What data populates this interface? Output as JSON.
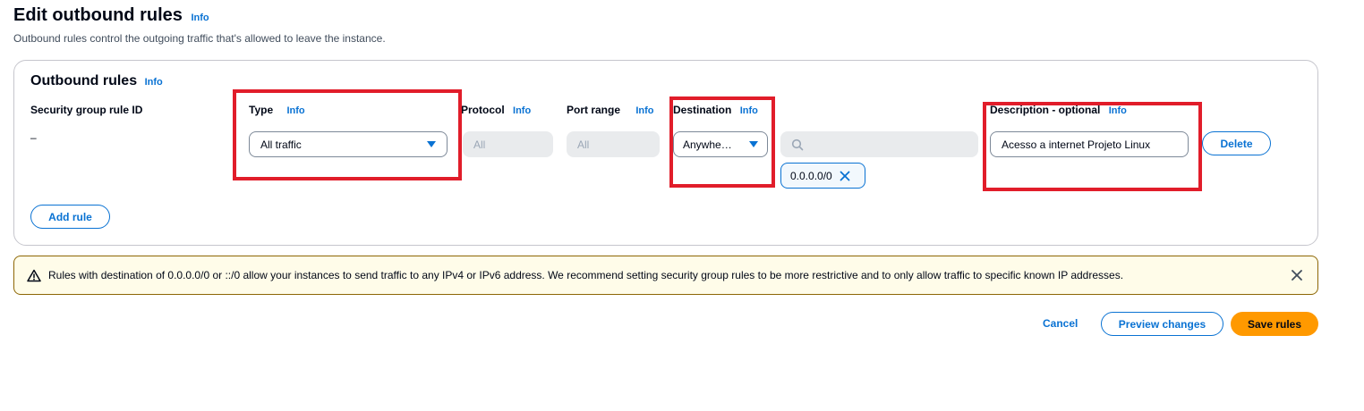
{
  "header": {
    "title": "Edit outbound rules",
    "info": "Info",
    "description": "Outbound rules control the outgoing traffic that's allowed to leave the instance."
  },
  "panel": {
    "title": "Outbound rules",
    "info": "Info",
    "columns": {
      "rule_id": "Security group rule ID",
      "type": "Type",
      "type_info": "Info",
      "protocol": "Protocol",
      "protocol_info": "Info",
      "port_range": "Port range",
      "port_info": "Info",
      "destination": "Destination",
      "destination_info": "Info",
      "description": "Description - optional",
      "description_info": "Info"
    },
    "row": {
      "rule_id": "–",
      "type": "All traffic",
      "protocol": "All",
      "port_range": "All",
      "destination": "Anywhe…",
      "destination_search_placeholder": "",
      "cidr_token": "0.0.0.0/0",
      "description": "Acesso a internet Projeto Linux",
      "delete_label": "Delete"
    },
    "add_rule_label": "Add rule"
  },
  "warning": {
    "text": "Rules with destination of 0.0.0.0/0 or ::/0 allow your instances to send traffic to any IPv4 or IPv6 address. We recommend setting security group rules to be more restrictive and to only allow traffic to specific known IP addresses."
  },
  "footer": {
    "cancel": "Cancel",
    "preview": "Preview changes",
    "save": "Save rules"
  },
  "colors": {
    "accent": "#0972d3",
    "primary_button": "#ff9900",
    "highlight": "#e11d2a",
    "warning_bg": "#fffce9"
  }
}
